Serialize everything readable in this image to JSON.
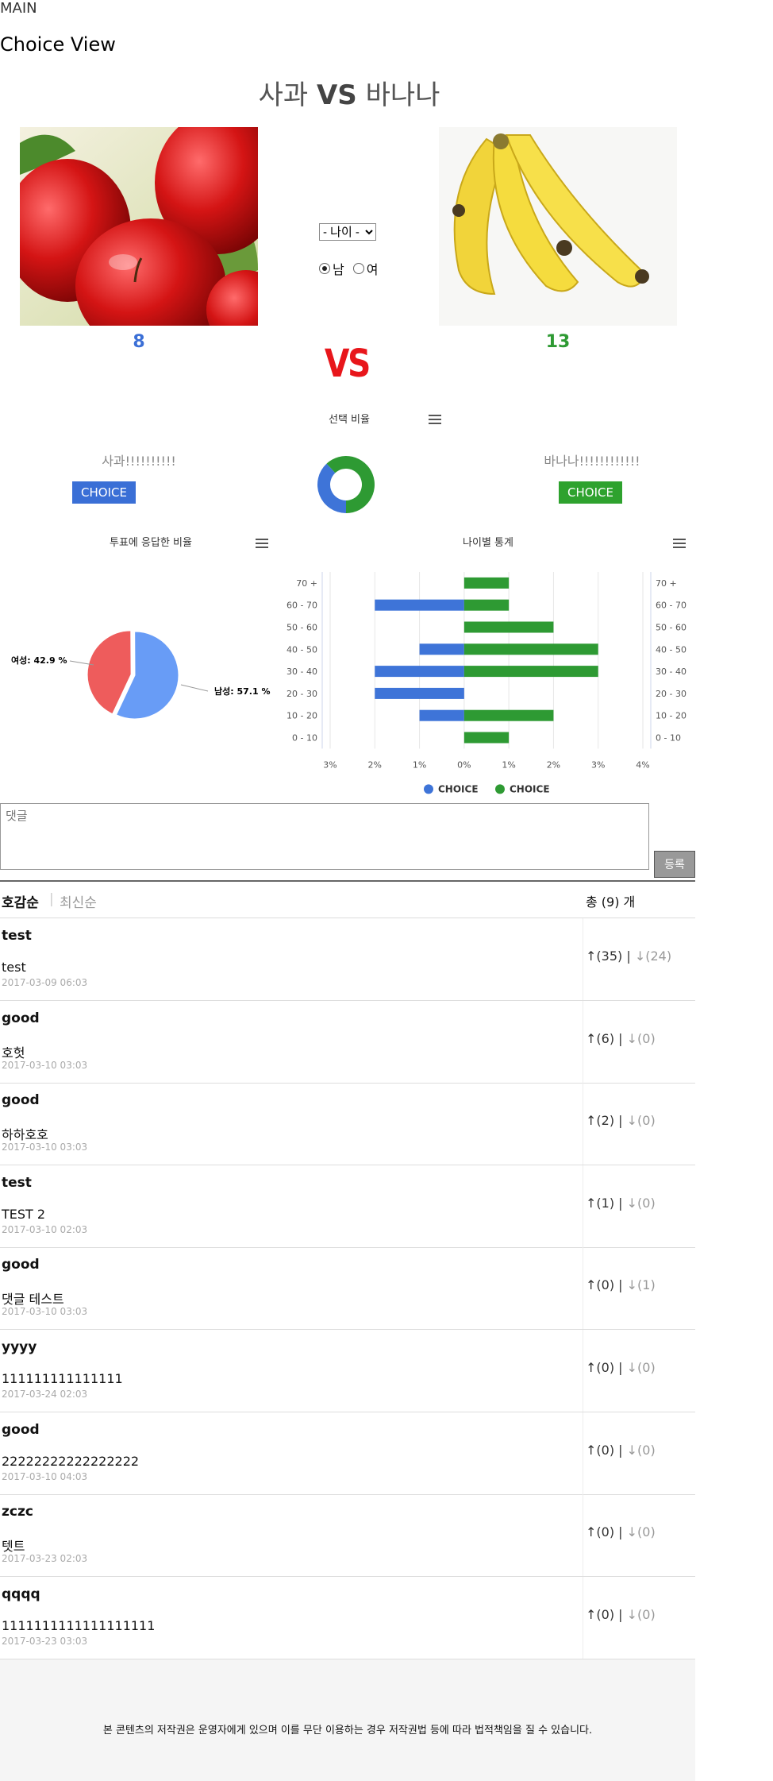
{
  "header": {
    "main_link": "MAIN",
    "view_title": "Choice View"
  },
  "matchup": {
    "left_name": "사과",
    "vs_text": "VS",
    "right_name": "바나나"
  },
  "left": {
    "count": "8",
    "count_color": "#3b6fd6",
    "choice_label": "사과!!!!!!!!!!",
    "button": "CHOICE",
    "button_color": "#3a6fd6",
    "image": "apple-photo"
  },
  "right": {
    "count": "13",
    "count_color": "#2e9a33",
    "choice_label": "바나나!!!!!!!!!!!!",
    "button": "CHOICE",
    "button_color": "#2ea22e",
    "image": "banana-photo"
  },
  "filters": {
    "age_select": "- 나이 -",
    "gender_male": "남",
    "gender_female": "여",
    "selected_gender": "남"
  },
  "vs_big": "VS",
  "charts": {
    "ratio_title": "선택 비율",
    "gender_title": "투표에 응답한 비율",
    "age_title": "나이별 통계"
  },
  "chart_data": [
    {
      "type": "pie",
      "title": "선택 비율",
      "style": "donut",
      "slices": [
        {
          "name": "CHOICE",
          "value": 8,
          "color": "#3e74d8"
        },
        {
          "name": "CHOICE",
          "value": 13,
          "color": "#2e9a33"
        }
      ]
    },
    {
      "type": "pie",
      "title": "투표에 응답한 비율",
      "slices": [
        {
          "name": "여성",
          "value": 42.9,
          "label": "여성: 42.9 %",
          "color": "#ee5c5c"
        },
        {
          "name": "남성",
          "value": 57.1,
          "label": "남성: 57.1 %",
          "color": "#689cf6"
        }
      ]
    },
    {
      "type": "bar",
      "orientation": "horizontal",
      "title": "나이별 통계",
      "categories": [
        "70 +",
        "60 - 70",
        "50 - 60",
        "40 - 50",
        "30 - 40",
        "20 - 30",
        "10 - 20",
        "0 - 10"
      ],
      "x_ticks": [
        "3%",
        "2%",
        "1%",
        "0%",
        "1%",
        "2%",
        "3%",
        "4%"
      ],
      "xlim": [
        -3,
        4
      ],
      "series": [
        {
          "name": "CHOICE",
          "color": "#3e74d8",
          "values": [
            0,
            -2,
            0,
            -1,
            -2,
            -2,
            -1,
            0
          ]
        },
        {
          "name": "CHOICE",
          "color": "#2e9a33",
          "values": [
            1,
            1,
            2,
            3,
            3,
            0,
            2,
            1
          ]
        }
      ],
      "legend": "bottom"
    }
  ],
  "comment_input": {
    "placeholder": "댓글",
    "submit": "등록"
  },
  "sort": {
    "popular": "호감순",
    "recent": "최신순",
    "total": "총 (9) 개"
  },
  "comments": [
    {
      "author": "test",
      "body": "test",
      "date": "2017-03-09 06:03",
      "up": "↑(35)",
      "down": "↓(24)"
    },
    {
      "author": "good",
      "body": "호헛",
      "date": "2017-03-10 03:03",
      "up": "↑(6)",
      "down": "↓(0)"
    },
    {
      "author": "good",
      "body": "하하호호",
      "date": "2017-03-10 03:03",
      "up": "↑(2)",
      "down": "↓(0)"
    },
    {
      "author": "test",
      "body": "TEST 2",
      "date": "2017-03-10 02:03",
      "up": "↑(1)",
      "down": "↓(0)"
    },
    {
      "author": "good",
      "body": "댓글 테스트",
      "date": "2017-03-10 03:03",
      "up": "↑(0)",
      "down": "↓(1)"
    },
    {
      "author": "yyyy",
      "body": "111111111111111",
      "date": "2017-03-24 02:03",
      "up": "↑(0)",
      "down": "↓(0)"
    },
    {
      "author": "good",
      "body": "22222222222222222",
      "date": "2017-03-10 04:03",
      "up": "↑(0)",
      "down": "↓(0)"
    },
    {
      "author": "zczc",
      "body": "텟트",
      "date": "2017-03-23 02:03",
      "up": "↑(0)",
      "down": "↓(0)"
    },
    {
      "author": "qqqq",
      "body": "1111111111111111111",
      "date": "2017-03-23 03:03",
      "up": "↑(0)",
      "down": "↓(0)"
    }
  ],
  "footer": "본 콘텐츠의 저작권은 운영자에게 있으며 이를 무단 이용하는 경우 저작권법 등에 따라 법적책임을 질 수 있습니다."
}
